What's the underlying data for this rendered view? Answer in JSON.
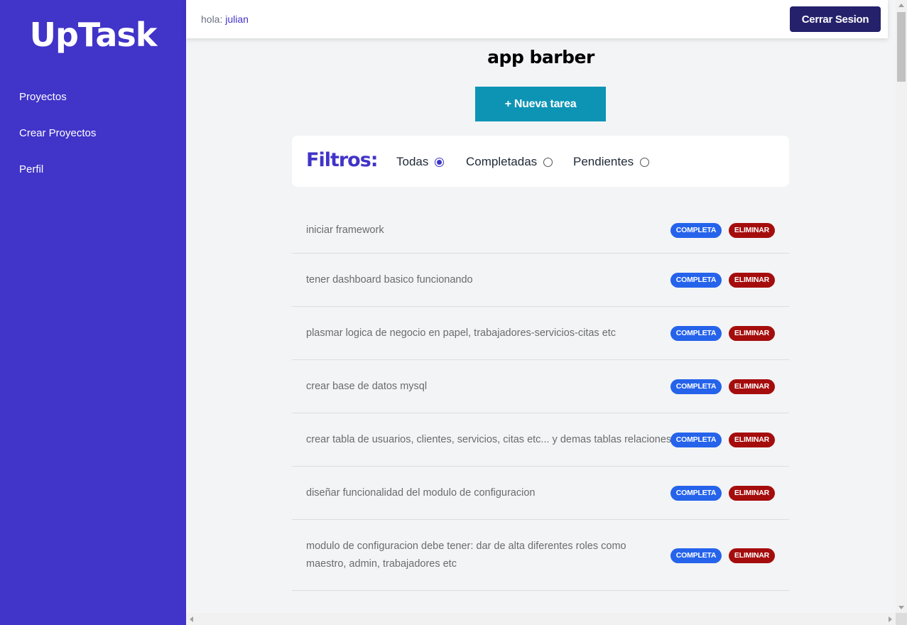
{
  "sidebar": {
    "logo": "UpTask",
    "items": [
      {
        "label": "Proyectos"
      },
      {
        "label": "Crear Proyectos"
      },
      {
        "label": "Perfil"
      }
    ]
  },
  "header": {
    "greeting_prefix": "hola:",
    "username": "julian",
    "logout_label": "Cerrar Sesion"
  },
  "main": {
    "project_title": "app barber",
    "new_task_label": "+ Nueva tarea",
    "filters": {
      "title": "Filtros:",
      "options": [
        {
          "label": "Todas",
          "checked": true
        },
        {
          "label": "Completadas",
          "checked": false
        },
        {
          "label": "Pendientes",
          "checked": false
        }
      ]
    },
    "tasks": [
      {
        "text": "iniciar framework",
        "status_label": "COMPLETA",
        "delete_label": "ELIMINAR"
      },
      {
        "text": "tener dashboard basico funcionando",
        "status_label": "COMPLETA",
        "delete_label": "ELIMINAR"
      },
      {
        "text": "plasmar logica de negocio en papel, trabajadores-servicios-citas etc",
        "status_label": "COMPLETA",
        "delete_label": "ELIMINAR"
      },
      {
        "text": "crear base de datos mysql",
        "status_label": "COMPLETA",
        "delete_label": "ELIMINAR"
      },
      {
        "text": "crear tabla de usuarios, clientes, servicios, citas etc... y demas tablas relaciones",
        "status_label": "COMPLETA",
        "delete_label": "ELIMINAR"
      },
      {
        "text": "diseñar funcionalidad del modulo de configuracion",
        "status_label": "COMPLETA",
        "delete_label": "ELIMINAR"
      },
      {
        "text": "modulo de configuracion debe tener: dar de alta diferentes roles como maestro, admin, trabajadores etc",
        "status_label": "COMPLETA",
        "delete_label": "ELIMINAR"
      }
    ]
  },
  "colors": {
    "sidebar_bg": "#4134c8",
    "logout_bg": "#25216b",
    "new_task_bg": "#0d94b5",
    "complete_badge": "#2563eb",
    "delete_badge": "#a50d0d"
  }
}
